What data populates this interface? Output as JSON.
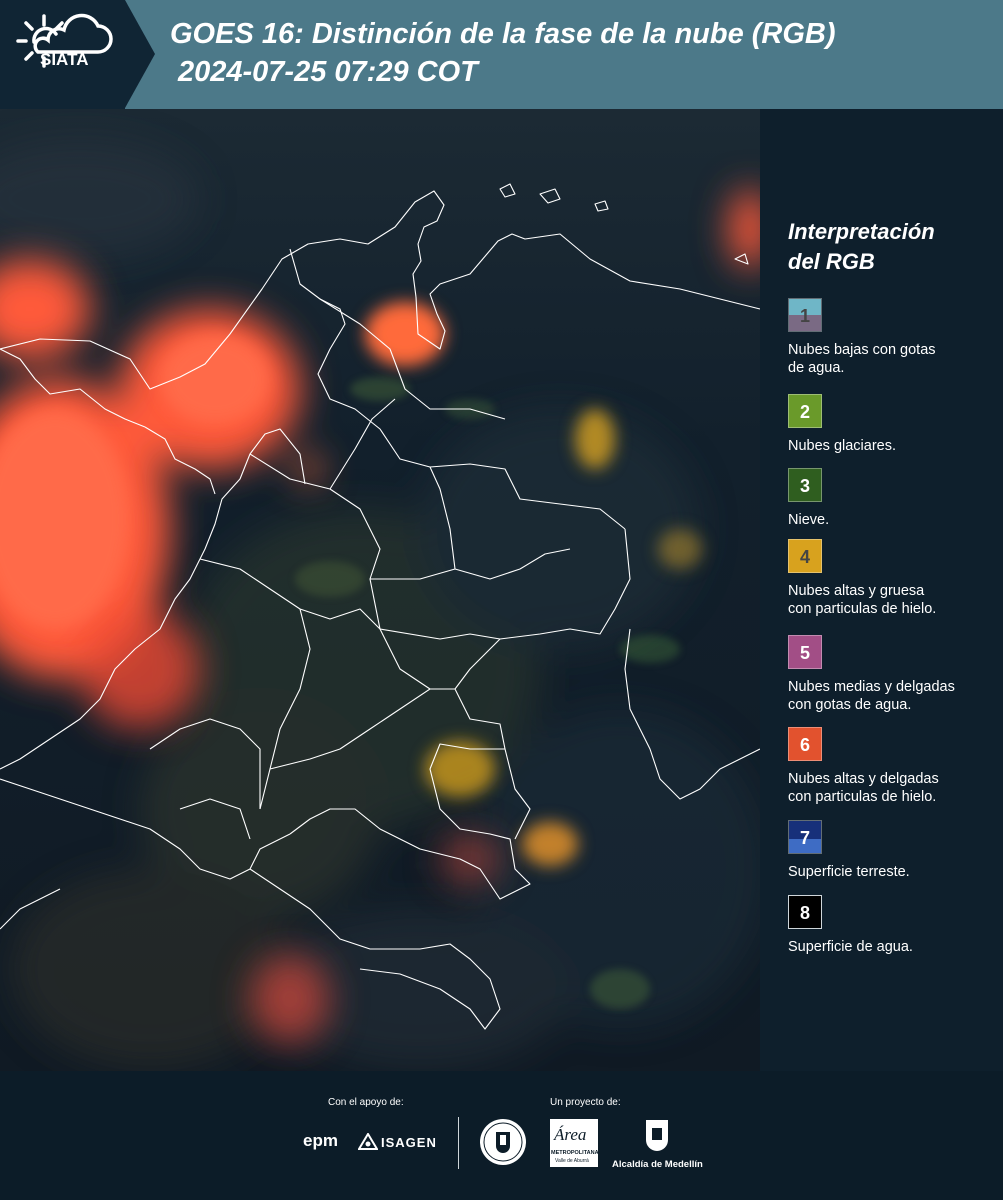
{
  "header": {
    "logo_text": "SIATA",
    "title": "GOES 16: Distinción de la fase de la nube (RGB)",
    "subtitle": "2024-07-25 07:29 COT"
  },
  "legend": {
    "title_line1": "Interpretación",
    "title_line2": "del RGB",
    "items": [
      {
        "number": "1",
        "label_lines": [
          "Nubes bajas con gotas",
          "de agua."
        ],
        "color_top": "#6fb6c7",
        "color_bottom": "#7a6a84",
        "num_color": "#444444"
      },
      {
        "number": "2",
        "label_lines": [
          "Nubes glaciares."
        ],
        "color_top": "#6a9a2a",
        "color_bottom": "#6a9a2a",
        "num_color": "#ffffff"
      },
      {
        "number": "3",
        "label_lines": [
          "Nieve."
        ],
        "color_top": "#2f5e1f",
        "color_bottom": "#2f5e1f",
        "num_color": "#ffffff"
      },
      {
        "number": "4",
        "label_lines": [
          "Nubes altas y gruesa",
          "con particulas de hielo."
        ],
        "color_top": "#d8a21e",
        "color_bottom": "#d8a21e",
        "num_color": "#444444"
      },
      {
        "number": "5",
        "label_lines": [
          "Nubes medias y delgadas",
          "con gotas de agua."
        ],
        "color_top": "#a24e86",
        "color_bottom": "#a24e86",
        "num_color": "#ffffff"
      },
      {
        "number": "6",
        "label_lines": [
          "Nubes altas y delgadas",
          "con particulas de hielo."
        ],
        "color_top": "#e2522e",
        "color_bottom": "#e2522e",
        "num_color": "#ffffff"
      },
      {
        "number": "7",
        "label_lines": [
          "Superficie terreste."
        ],
        "color_top": "#17307a",
        "color_bottom": "#3e6cc4",
        "num_color": "#ffffff"
      },
      {
        "number": "8",
        "label_lines": [
          "Superficie de agua."
        ],
        "color_top": "#000000",
        "color_bottom": "#000000",
        "num_color": "#ffffff"
      }
    ]
  },
  "footer": {
    "support_label": "Con el apoyo de:",
    "project_label": "Un proyecto de:",
    "epm_logo": "epm",
    "isagen_logo": "ISAGEN",
    "area_logo": "Área",
    "area_sub1": "METROPOLITANA",
    "area_sub2": "Valle de Aburrá",
    "alcaldia_logo": "Alcaldía de Medellín"
  },
  "colors": {
    "header_bg": "#4c7989",
    "sidebar_bg": "#0e1f2c",
    "cloud_high_thin": "#ff5a3a",
    "cloud_thick_ice": "#d8a21e"
  }
}
